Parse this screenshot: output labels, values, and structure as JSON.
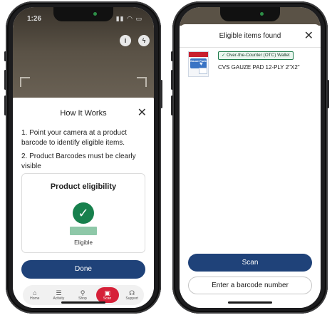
{
  "left_phone": {
    "status_time": "1:26",
    "sheet_title": "How It Works",
    "instructions": [
      "1. Point your camera at a product barcode to identify eligible items.",
      "2. Product Barcodes must be clearly visible"
    ],
    "eligibility_card": {
      "title": "Product eligibility",
      "status_label": "Eligible"
    },
    "done_button": "Done",
    "tabs": [
      {
        "label": "Home",
        "icon": "home-icon",
        "glyph": "⌂"
      },
      {
        "label": "Activity",
        "icon": "activity-icon",
        "glyph": "☰"
      },
      {
        "label": "Shop",
        "icon": "shop-icon",
        "glyph": "⚲"
      },
      {
        "label": "Scan",
        "icon": "scan-icon",
        "glyph": "▣",
        "active": true
      },
      {
        "label": "Support",
        "icon": "support-icon",
        "glyph": "☊"
      }
    ],
    "accent_color": "#1f4279",
    "success_color": "#17804d",
    "scan_tab_color": "#d62139"
  },
  "right_phone": {
    "title": "Eligible items found",
    "badge": "Over-the-Counter (OTC) Wallet",
    "product_name": "CVS GAUZE PAD 12-PLY 2\"X2\"",
    "product_image_text": "Gauze Pads",
    "scan_button": "Scan",
    "barcode_button": "Enter a barcode number"
  }
}
